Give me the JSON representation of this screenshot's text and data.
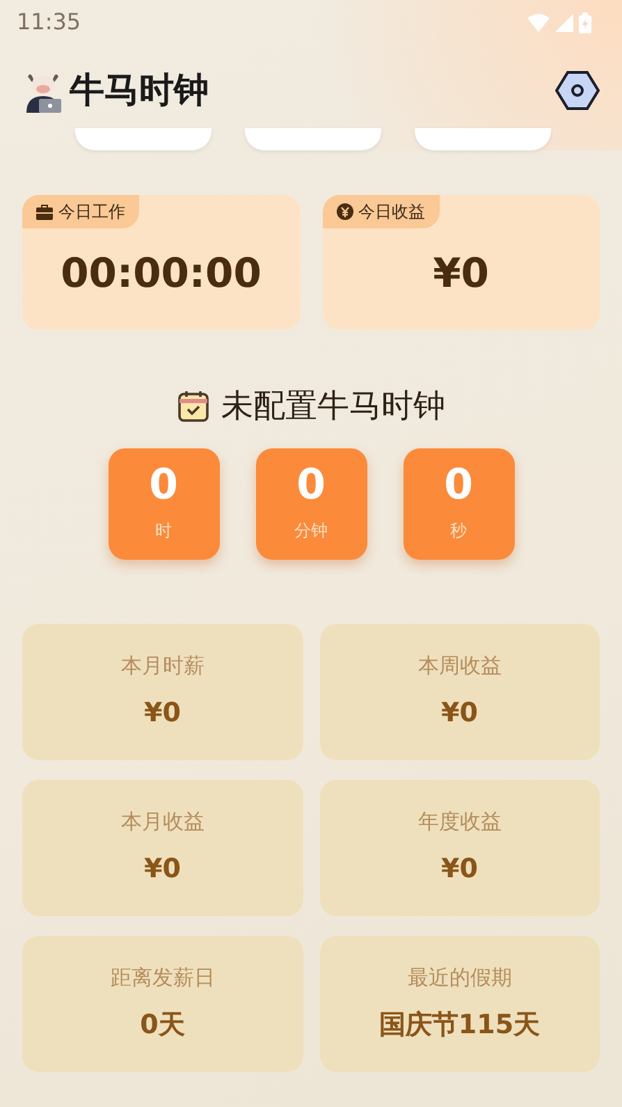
{
  "status_bar": {
    "time": "11:35"
  },
  "header": {
    "title": "牛马时钟"
  },
  "today": [
    {
      "kind": "work",
      "label": "今日工作",
      "value": "00:00:00"
    },
    {
      "kind": "income",
      "label": "今日收益",
      "value": "¥0"
    }
  ],
  "clock_title": "未配置牛马时钟",
  "timer": [
    {
      "value": "0",
      "unit": "时"
    },
    {
      "value": "0",
      "unit": "分钟"
    },
    {
      "value": "0",
      "unit": "秒"
    }
  ],
  "stats": [
    {
      "label": "本月时薪",
      "value": "¥0"
    },
    {
      "label": "本周收益",
      "value": "¥0"
    },
    {
      "label": "本月收益",
      "value": "¥0"
    },
    {
      "label": "年度收益",
      "value": "¥0"
    },
    {
      "label": "距离发薪日",
      "value": "0天"
    },
    {
      "label": "最近的假期",
      "value": "国庆节115天"
    }
  ]
}
